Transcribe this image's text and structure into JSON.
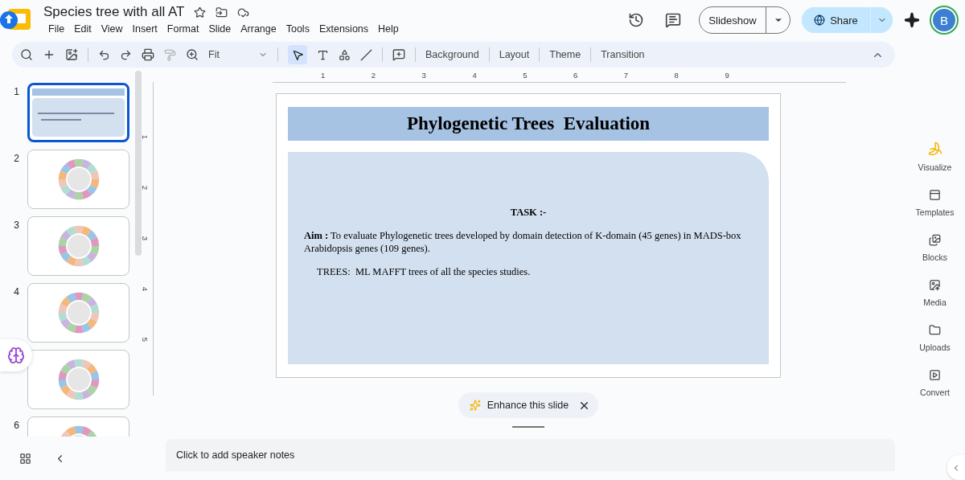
{
  "document": {
    "title": "Species tree with all AT"
  },
  "menu": [
    "File",
    "Edit",
    "View",
    "Insert",
    "Format",
    "Slide",
    "Arrange",
    "Tools",
    "Extensions",
    "Help"
  ],
  "header": {
    "slideshow": "Slideshow",
    "share": "Share",
    "avatar": "B"
  },
  "toolbar": {
    "zoom": "Fit",
    "buttons": [
      "Background",
      "Layout",
      "Theme",
      "Transition"
    ]
  },
  "ruler": {
    "horizontal": [
      "1",
      "2",
      "3",
      "4",
      "5",
      "6",
      "7",
      "8",
      "9"
    ],
    "vertical": [
      "1",
      "2",
      "3",
      "4",
      "5"
    ]
  },
  "slides": [
    {
      "number": "1",
      "selected": true,
      "kind": "title"
    },
    {
      "number": "2",
      "selected": false,
      "kind": "tree"
    },
    {
      "number": "3",
      "selected": false,
      "kind": "tree"
    },
    {
      "number": "4",
      "selected": false,
      "kind": "tree"
    },
    {
      "selected": false,
      "kind": "tree"
    },
    {
      "number": "6",
      "selected": false,
      "kind": "tree"
    }
  ],
  "slide": {
    "title": "Phylogenetic Trees  Evaluation",
    "task": "TASK :-",
    "aim": "**Aim :** To evaluate Phylogenetic trees developed by domain detection of K-domain (45 genes) in MADS-box Arabidopsis genes (109 genes).",
    "trees": "TREES:  ML MAFFT trees of all the species studies."
  },
  "enhance": "Enhance this slide",
  "notes": {
    "placeholder": "Click to add speaker notes"
  },
  "side_panel": [
    {
      "kind": "visualize",
      "label": "Visualize"
    },
    {
      "kind": "templates",
      "label": "Templates"
    },
    {
      "kind": "blocks",
      "label": "Blocks"
    },
    {
      "kind": "media",
      "label": "Media"
    },
    {
      "kind": "uploads",
      "label": "Uploads"
    },
    {
      "kind": "convert",
      "label": "Convert"
    }
  ]
}
